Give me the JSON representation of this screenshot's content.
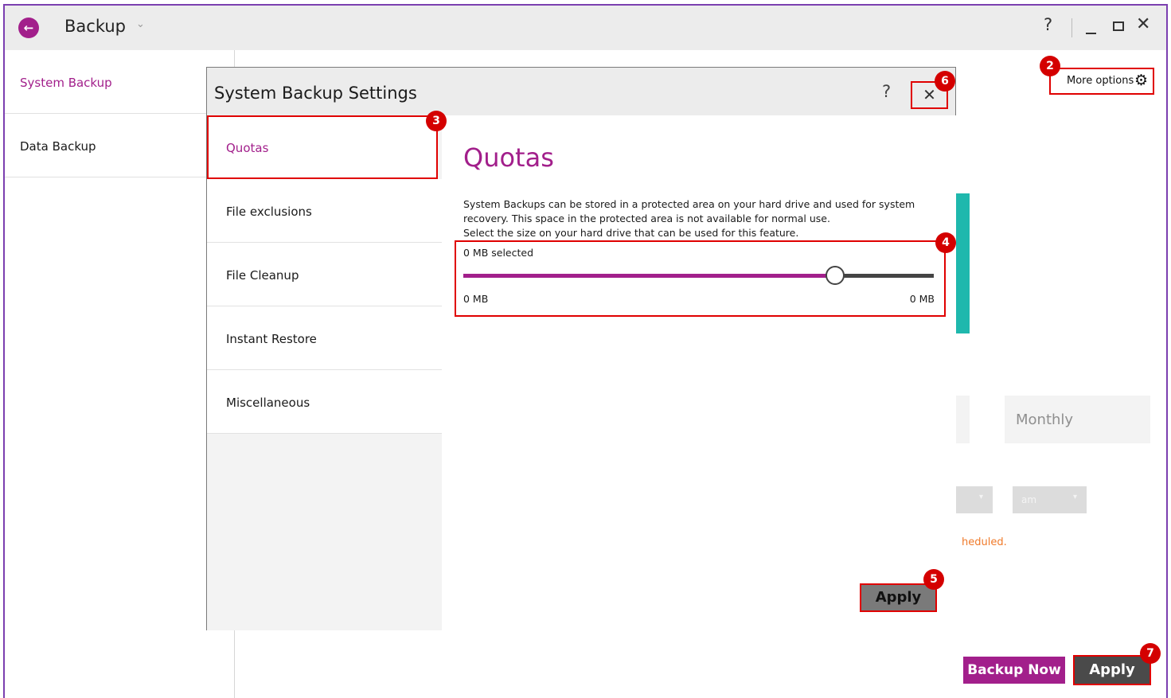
{
  "window": {
    "title": "Backup",
    "help": "?",
    "close": "✕"
  },
  "nav": {
    "items": [
      {
        "label": "System Backup",
        "active": true
      },
      {
        "label": "Data Backup",
        "active": false
      }
    ]
  },
  "main": {
    "more_options": "More options",
    "monthly": "Monthly",
    "time_dropdown_value": "am",
    "schedule_note": "heduled.",
    "backup_now": "Backup Now",
    "apply": "Apply"
  },
  "dialog": {
    "title": "System Backup Settings",
    "help": "?",
    "close": "✕",
    "tabs": [
      {
        "label": "Quotas",
        "active": true
      },
      {
        "label": "File exclusions",
        "active": false
      },
      {
        "label": "File Cleanup",
        "active": false
      },
      {
        "label": "Instant Restore",
        "active": false
      },
      {
        "label": "Miscellaneous",
        "active": false
      }
    ],
    "quotas": {
      "heading": "Quotas",
      "description_1": "System Backups can be stored in a protected area on your hard drive and used for system recovery. This space in the protected area is not available for normal use.",
      "description_2": "Select the size on your hard drive that can be used for this feature.",
      "selected_label": "0 MB selected",
      "min_label": "0 MB",
      "max_label": "0 MB",
      "slider_fraction": 0.79
    },
    "apply": "Apply"
  },
  "badges": [
    "2",
    "3",
    "4",
    "5",
    "6",
    "7"
  ],
  "colors": {
    "accent": "#a21f8b",
    "highlight": "#e00000",
    "teal": "#1fb8ad",
    "warning": "#f07a2a"
  }
}
